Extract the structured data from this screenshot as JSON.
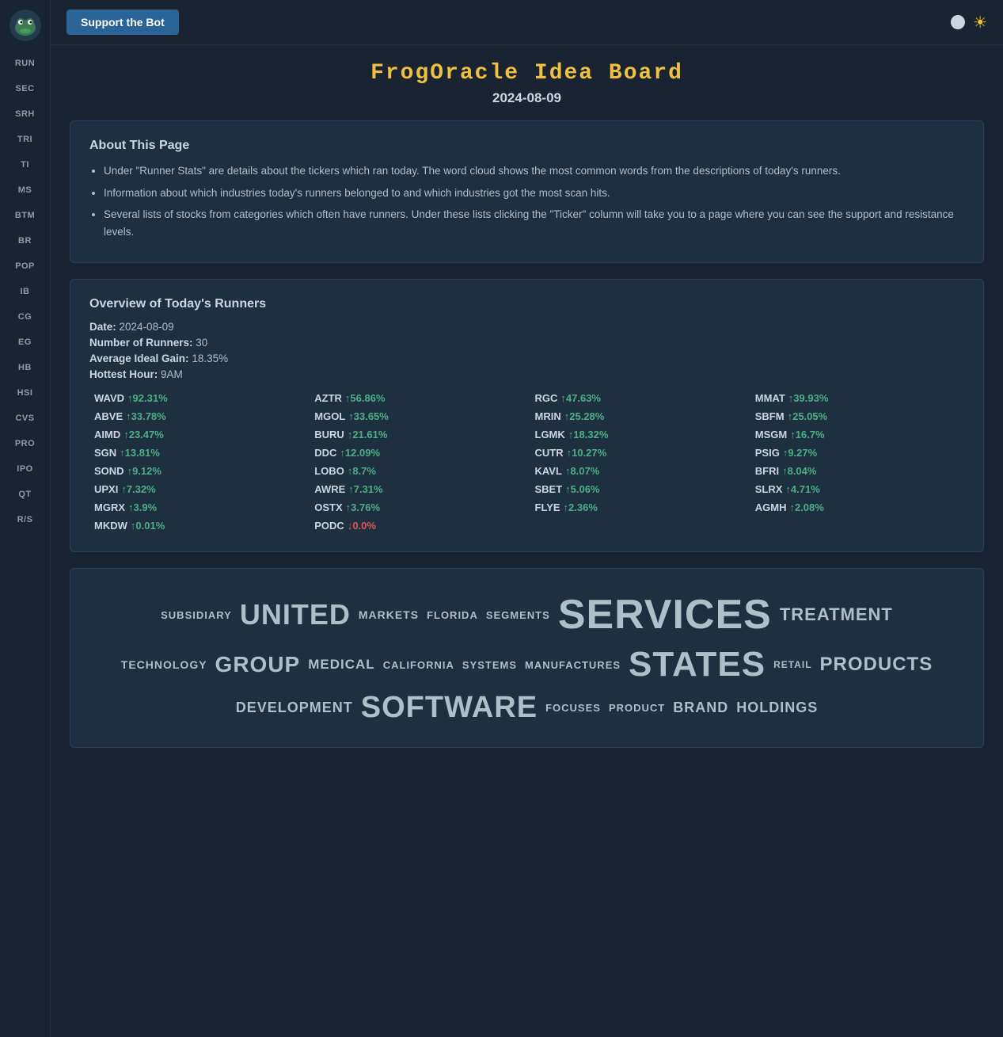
{
  "sidebar": {
    "logo": "frog-logo",
    "items": [
      {
        "label": "RUN",
        "id": "run"
      },
      {
        "label": "SEC",
        "id": "sec"
      },
      {
        "label": "SRH",
        "id": "srh"
      },
      {
        "label": "TRI",
        "id": "tri"
      },
      {
        "label": "TI",
        "id": "ti"
      },
      {
        "label": "MS",
        "id": "ms"
      },
      {
        "label": "BTM",
        "id": "btm"
      },
      {
        "label": "BR",
        "id": "br"
      },
      {
        "label": "POP",
        "id": "pop"
      },
      {
        "label": "IB",
        "id": "ib"
      },
      {
        "label": "CG",
        "id": "cg"
      },
      {
        "label": "EG",
        "id": "eg"
      },
      {
        "label": "HB",
        "id": "hb"
      },
      {
        "label": "HSI",
        "id": "hsi"
      },
      {
        "label": "CVS",
        "id": "cvs"
      },
      {
        "label": "PRO",
        "id": "pro"
      },
      {
        "label": "IPO",
        "id": "ipo"
      },
      {
        "label": "QT",
        "id": "qt"
      },
      {
        "label": "R/S",
        "id": "rs"
      }
    ]
  },
  "topbar": {
    "support_btn": "Support the Bot"
  },
  "page": {
    "title": "FrogOracle Idea Board",
    "date": "2024-08-09"
  },
  "about": {
    "title": "About This Page",
    "bullets": [
      "Under \"Runner Stats\" are details about the tickers which ran today. The word cloud shows the most common words from the descriptions of today's runners.",
      "Information about which industries today's runners belonged to and which industries got the most scan hits.",
      "Several lists of stocks from categories which often have runners. Under these lists clicking the \"Ticker\" column will take you to a page where you can see the support and resistance levels."
    ]
  },
  "overview": {
    "title": "Overview of Today's Runners",
    "date_label": "Date:",
    "date_value": "2024-08-09",
    "runners_label": "Number of Runners:",
    "runners_value": "30",
    "gain_label": "Average Ideal Gain:",
    "gain_value": "18.35%",
    "hour_label": "Hottest Hour:",
    "hour_value": "9AM",
    "runners": [
      {
        "ticker": "WAVD",
        "gain": "↑92.31%",
        "up": true
      },
      {
        "ticker": "AZTR",
        "gain": "↑56.86%",
        "up": true
      },
      {
        "ticker": "RGC",
        "gain": "↑47.63%",
        "up": true
      },
      {
        "ticker": "MMAT",
        "gain": "↑39.93%",
        "up": true
      },
      {
        "ticker": "ABVE",
        "gain": "↑33.78%",
        "up": true
      },
      {
        "ticker": "MGOL",
        "gain": "↑33.65%",
        "up": true
      },
      {
        "ticker": "MRIN",
        "gain": "↑25.28%",
        "up": true
      },
      {
        "ticker": "SBFM",
        "gain": "↑25.05%",
        "up": true
      },
      {
        "ticker": "AIMD",
        "gain": "↑23.47%",
        "up": true
      },
      {
        "ticker": "BURU",
        "gain": "↑21.61%",
        "up": true
      },
      {
        "ticker": "LGMK",
        "gain": "↑18.32%",
        "up": true
      },
      {
        "ticker": "MSGM",
        "gain": "↑16.7%",
        "up": true
      },
      {
        "ticker": "SGN",
        "gain": "↑13.81%",
        "up": true
      },
      {
        "ticker": "DDC",
        "gain": "↑12.09%",
        "up": true
      },
      {
        "ticker": "CUTR",
        "gain": "↑10.27%",
        "up": true
      },
      {
        "ticker": "PSIG",
        "gain": "↑9.27%",
        "up": true
      },
      {
        "ticker": "SOND",
        "gain": "↑9.12%",
        "up": true
      },
      {
        "ticker": "LOBO",
        "gain": "↑8.7%",
        "up": true
      },
      {
        "ticker": "KAVL",
        "gain": "↑8.07%",
        "up": true
      },
      {
        "ticker": "BFRI",
        "gain": "↑8.04%",
        "up": true
      },
      {
        "ticker": "UPXI",
        "gain": "↑7.32%",
        "up": true
      },
      {
        "ticker": "AWRE",
        "gain": "↑7.31%",
        "up": true
      },
      {
        "ticker": "SBET",
        "gain": "↑5.06%",
        "up": true
      },
      {
        "ticker": "SLRX",
        "gain": "↑4.71%",
        "up": true
      },
      {
        "ticker": "MGRX",
        "gain": "↑3.9%",
        "up": true
      },
      {
        "ticker": "OSTX",
        "gain": "↑3.76%",
        "up": true
      },
      {
        "ticker": "FLYE",
        "gain": "↑2.36%",
        "up": true
      },
      {
        "ticker": "AGMH",
        "gain": "↑2.08%",
        "up": true
      },
      {
        "ticker": "MKDW",
        "gain": "↑0.01%",
        "up": true
      },
      {
        "ticker": "PODC",
        "gain": "↓0.0%",
        "up": false
      }
    ]
  },
  "wordcloud": {
    "rows": [
      [
        {
          "text": "SUBSIDIARY",
          "size": 13
        },
        {
          "text": "UNITED",
          "size": 36
        },
        {
          "text": "MARKETS",
          "size": 14
        },
        {
          "text": "FLORIDA",
          "size": 13
        },
        {
          "text": "SEGMENTS",
          "size": 13
        },
        {
          "text": "SERVICES",
          "size": 52
        },
        {
          "text": "TREATMENT",
          "size": 22
        }
      ],
      [
        {
          "text": "TECHNOLOGY",
          "size": 14
        },
        {
          "text": "GROUP",
          "size": 28
        },
        {
          "text": "MEDICAL",
          "size": 17
        },
        {
          "text": "CALIFORNIA",
          "size": 13
        },
        {
          "text": "SYSTEMS",
          "size": 13
        },
        {
          "text": "MANUFACTURES",
          "size": 13
        },
        {
          "text": "STATES",
          "size": 44
        },
        {
          "text": "RETAIL",
          "size": 12
        },
        {
          "text": "PRODUCTS",
          "size": 24
        }
      ],
      [
        {
          "text": "DEVELOPMENT",
          "size": 18
        },
        {
          "text": "SOFTWARE",
          "size": 38
        },
        {
          "text": "FOCUSES",
          "size": 13
        },
        {
          "text": "PRODUCT",
          "size": 13
        },
        {
          "text": "BRAND",
          "size": 18
        },
        {
          "text": "HOLDINGS",
          "size": 18
        }
      ]
    ]
  }
}
